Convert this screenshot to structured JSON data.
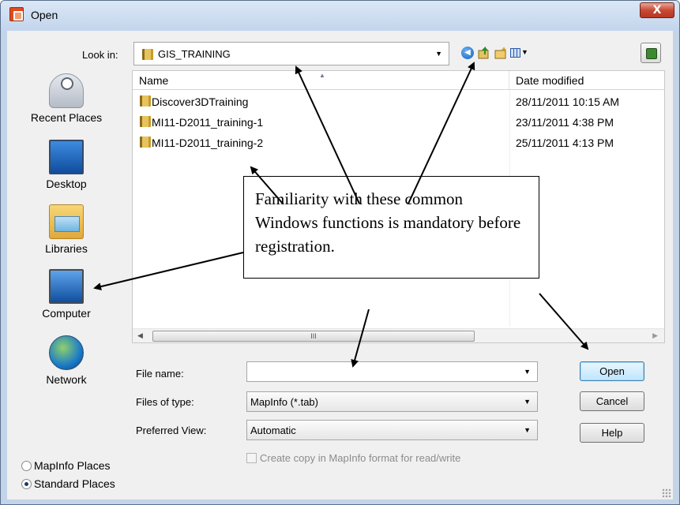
{
  "window": {
    "title": "Open",
    "close_glyph": "X"
  },
  "toolbar": {
    "look_in_label": "Look in:",
    "look_in_value": "GIS_TRAINING",
    "icons": [
      "back-icon",
      "up-folder-icon",
      "new-folder-icon",
      "view-menu-icon",
      "desktop-icon"
    ]
  },
  "places": {
    "items": [
      {
        "label": "Recent Places",
        "icon": "recent-places-icon"
      },
      {
        "label": "Desktop",
        "icon": "desktop-icon"
      },
      {
        "label": "Libraries",
        "icon": "libraries-icon"
      },
      {
        "label": "Computer",
        "icon": "computer-icon"
      },
      {
        "label": "Network",
        "icon": "network-icon"
      }
    ],
    "radio_mapinfo": "MapInfo Places",
    "radio_standard": "Standard Places",
    "selected": "Standard Places"
  },
  "filelist": {
    "columns": [
      "Name",
      "Date modified"
    ],
    "rows": [
      {
        "name": "Discover3DTraining",
        "date": "28/11/2011 10:15 AM"
      },
      {
        "name": "MI11-D2011_training-1",
        "date": "23/11/2011 4:38 PM"
      },
      {
        "name": "MI11-D2011_training-2",
        "date": "25/11/2011 4:13 PM"
      }
    ],
    "scroll_thumb_glyph": "III"
  },
  "form": {
    "file_name_label": "File name:",
    "file_name_value": "",
    "files_of_type_label": "Files of type:",
    "files_of_type_value": "MapInfo (*.tab)",
    "preferred_view_label": "Preferred View:",
    "preferred_view_value": "Automatic",
    "copy_checkbox_label": "Create copy in MapInfo format for read/write",
    "copy_checked": false
  },
  "buttons": {
    "open": "Open",
    "cancel": "Cancel",
    "help": "Help"
  },
  "callout": {
    "text": "Familiarity with these common Windows functions is mandatory before registration."
  }
}
